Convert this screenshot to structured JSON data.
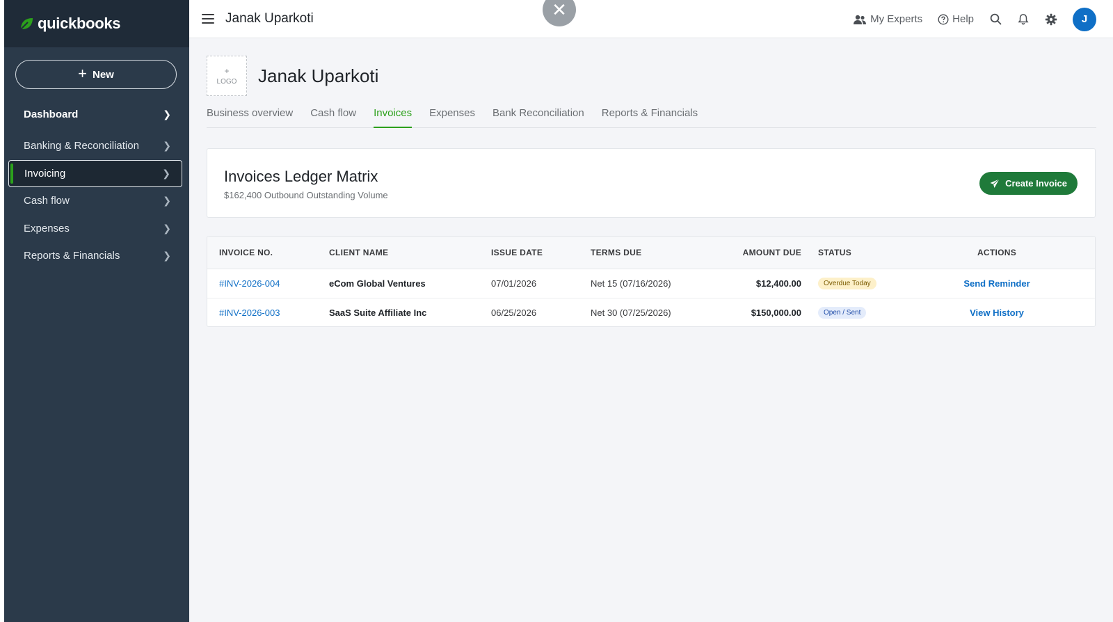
{
  "brand": {
    "name": "quickbooks"
  },
  "sidebar": {
    "new_label": "New",
    "items": [
      {
        "label": "Dashboard"
      },
      {
        "label": "Banking & Reconciliation"
      },
      {
        "label": "Invoicing"
      },
      {
        "label": "Cash flow"
      },
      {
        "label": "Expenses"
      },
      {
        "label": "Reports & Financials"
      }
    ]
  },
  "topbar": {
    "title": "Janak Uparkoti",
    "my_experts": "My Experts",
    "help": "Help",
    "avatar_initial": "J"
  },
  "company": {
    "logo_plus": "+",
    "logo_label": "LOGO",
    "name": "Janak Uparkoti"
  },
  "tabs": [
    {
      "label": "Business overview"
    },
    {
      "label": "Cash flow"
    },
    {
      "label": "Invoices"
    },
    {
      "label": "Expenses"
    },
    {
      "label": "Bank Reconciliation"
    },
    {
      "label": "Reports & Financials"
    }
  ],
  "summary": {
    "title": "Invoices Ledger Matrix",
    "subtitle": "$162,400 Outbound Outstanding Volume",
    "create_label": "Create Invoice"
  },
  "table": {
    "headers": [
      "INVOICE NO.",
      "CLIENT NAME",
      "ISSUE DATE",
      "TERMS DUE",
      "AMOUNT DUE",
      "STATUS",
      "ACTIONS"
    ],
    "rows": [
      {
        "invoice_no": "#INV-2026-004",
        "client": "eCom Global Ventures",
        "issue_date": "07/01/2026",
        "terms": "Net 15 (07/16/2026)",
        "amount": "$12,400.00",
        "status": "Overdue Today",
        "action": "Send Reminder"
      },
      {
        "invoice_no": "#INV-2026-003",
        "client": "SaaS Suite Affiliate Inc",
        "issue_date": "06/25/2026",
        "terms": "Net 30 (07/25/2026)",
        "amount": "$150,000.00",
        "status": "Open / Sent",
        "action": "View History"
      }
    ]
  },
  "colors": {
    "brand_green": "#2ca01c",
    "sidebar_bg": "#2b3a4a",
    "primary_button": "#1f7a3a",
    "link_blue": "#0f6fc6"
  },
  "icons": [
    "leaf-logo-icon",
    "plus-icon",
    "chevron-right-icon",
    "hamburger-icon",
    "close-icon",
    "people-icon",
    "help-icon",
    "search-icon",
    "bell-icon",
    "gear-icon",
    "paper-plane-icon"
  ]
}
